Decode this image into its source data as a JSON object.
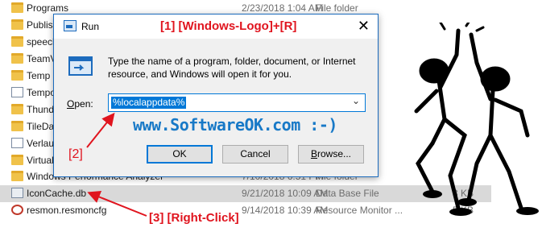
{
  "explorer": {
    "rows": [
      {
        "name": "Programs",
        "date": "2/23/2018 1:04 AM",
        "type": "File folder",
        "size": "",
        "icon": "folder-icon"
      },
      {
        "name": "Publish",
        "date": "",
        "type": "",
        "size": "",
        "icon": "folder-icon"
      },
      {
        "name": "speech",
        "date": "",
        "type": "",
        "size": "",
        "icon": "folder-icon"
      },
      {
        "name": "TeamV",
        "date": "",
        "type": "",
        "size": "",
        "icon": "folder-icon"
      },
      {
        "name": "Temp",
        "date": "",
        "type": "",
        "size": "",
        "icon": "folder-icon"
      },
      {
        "name": "Tempo",
        "date": "",
        "type": "",
        "size": "",
        "icon": "file-icon"
      },
      {
        "name": "Thunde",
        "date": "",
        "type": "",
        "size": "",
        "icon": "folder-icon"
      },
      {
        "name": "TileDat",
        "date": "",
        "type": "",
        "size": "",
        "icon": "folder-icon"
      },
      {
        "name": "Verlauf",
        "date": "",
        "type": "",
        "size": "",
        "icon": "file-icon"
      },
      {
        "name": "VirtualS",
        "date": "",
        "type": "",
        "size": "",
        "icon": "folder-icon"
      },
      {
        "name": "Windows Performance Analyzer",
        "date": "7/10/2018 6:51 PM",
        "type": "File folder",
        "size": "",
        "icon": "folder-icon"
      },
      {
        "name": "IconCache.db",
        "date": "9/21/2018 10:09 AM",
        "type": "Data Base File",
        "size": "3 KB",
        "icon": "database-file-icon"
      },
      {
        "name": "resmon.resmoncfg",
        "date": "9/14/2018 10:39 AM",
        "type": "Resource Monitor ...",
        "size": "5 KB",
        "icon": "config-file-icon"
      }
    ]
  },
  "run_dialog": {
    "title": "Run",
    "close_label": "✕",
    "description": "Type the name of a program, folder, document, or Internet resource, and Windows will open it for you.",
    "open_label_prefix": "",
    "open_label_accel": "O",
    "open_label_rest": "pen:",
    "input_value": "%localappdata%",
    "ok_label": "OK",
    "cancel_label": "Cancel",
    "browse_label_prefix": "",
    "browse_label_accel": "B",
    "browse_label_rest": "rowse..."
  },
  "annotations": {
    "step1": "[1]  [Windows-Logo]+[R]",
    "website": "www.SoftwareOK.com :-)",
    "step2": "[2]",
    "step3": "[3] [Right-Click]"
  },
  "colors": {
    "annotation_red": "#e0141e",
    "website_blue": "#1879c7",
    "accent_blue": "#0078d7"
  }
}
